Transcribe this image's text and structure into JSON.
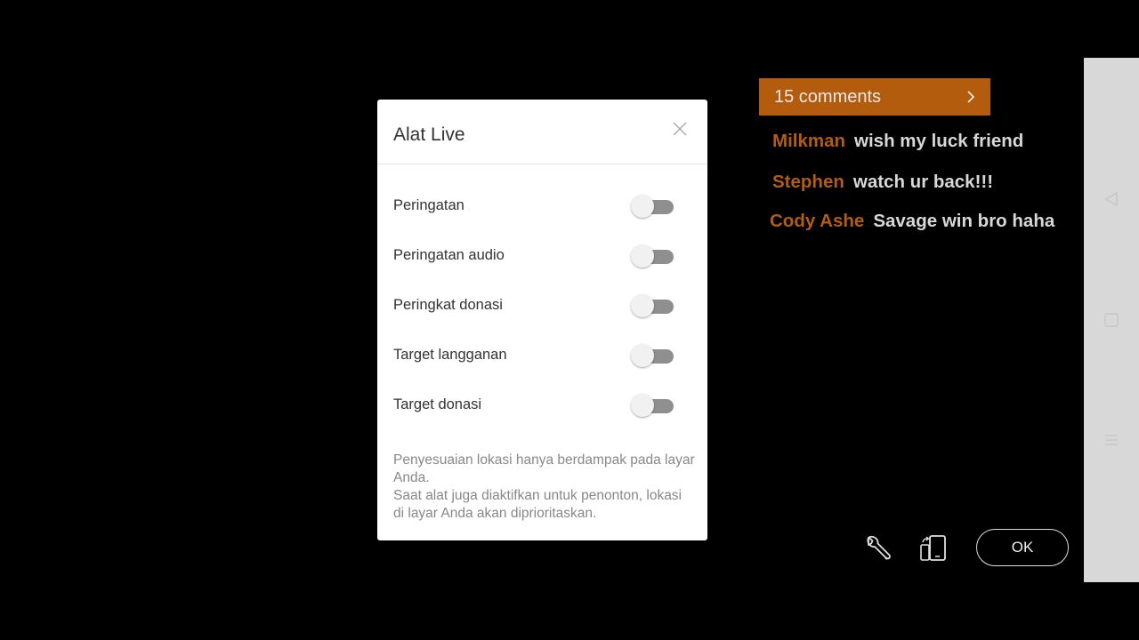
{
  "dialog": {
    "title": "Alat Live",
    "options": [
      {
        "label": "Peringatan",
        "enabled": false
      },
      {
        "label": "Peringatan audio",
        "enabled": false
      },
      {
        "label": "Peringkat donasi",
        "enabled": false
      },
      {
        "label": "Target langganan",
        "enabled": false
      },
      {
        "label": "Target donasi",
        "enabled": false
      }
    ],
    "note_line1": "Penyesuaian lokasi hanya berdampak pada layar Anda.",
    "note_line2": "Saat alat juga diaktifkan untuk penonton, lokasi di layar Anda akan diprioritaskan."
  },
  "comments": {
    "count_label": "15 comments",
    "items": [
      {
        "author": "Milkman",
        "text": "wish my luck friend"
      },
      {
        "author": "Stephen",
        "text": "watch ur back!!!"
      },
      {
        "author": "Cody Ashe",
        "text": "Savage win bro haha"
      }
    ]
  },
  "controls": {
    "ok_label": "OK",
    "icons": [
      "wrench-icon",
      "rotate-phone-icon"
    ]
  },
  "nav_bar": {
    "icons": [
      "back-icon",
      "home-icon",
      "menu-icon"
    ]
  },
  "colors": {
    "accent": "#b35c0e",
    "author": "#b35c16",
    "background": "#000000",
    "toggle_track_off": "#8f8f8f",
    "nav_bar": "#d8d8d8"
  }
}
